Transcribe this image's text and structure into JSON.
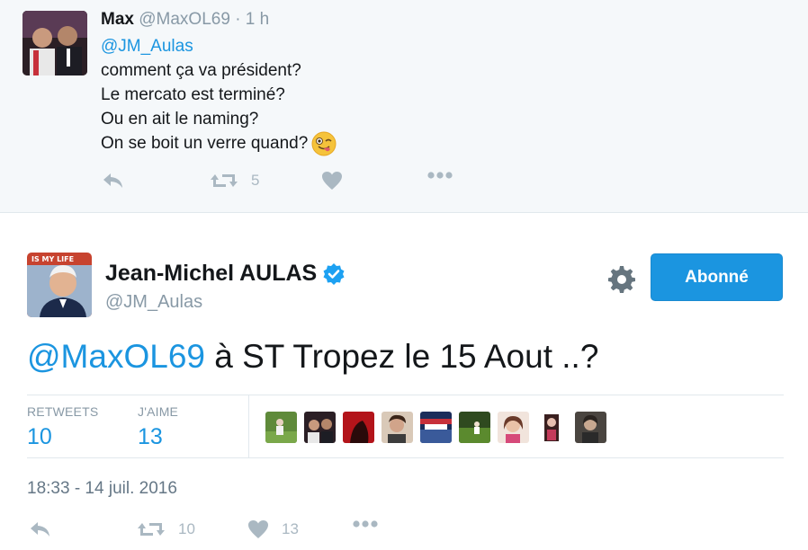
{
  "reply": {
    "name": "Max",
    "handle": "@MaxOL69",
    "time": "· 1 h",
    "mention": "@JM_Aulas",
    "lines": [
      "comment ça va président?",
      "Le mercato est terminé?",
      "Ou en ait le naming?",
      "On se boit un verre quand?"
    ],
    "emoji": "winking-face-tongue-emoji",
    "retweet_count": "5"
  },
  "tweet": {
    "author_name": "Jean-Michel AULAS",
    "author_handle": "@JM_Aulas",
    "avatar_caption": "IS MY LIFE",
    "follow_label": "Abonné",
    "mention": "@MaxOL69",
    "text": " à ST Tropez le 15 Aout ..?",
    "retweets_label": "RETWEETS",
    "retweets_count": "10",
    "likes_label": "J'AIME",
    "likes_count": "13",
    "timestamp": "18:33 - 14 juil. 2016",
    "action_retweet_count": "10",
    "action_like_count": "13"
  },
  "colors": {
    "accent": "#1b95e0",
    "muted": "#8899a6",
    "icon": "#aab8c2",
    "background_reply": "#f5f8fa"
  }
}
